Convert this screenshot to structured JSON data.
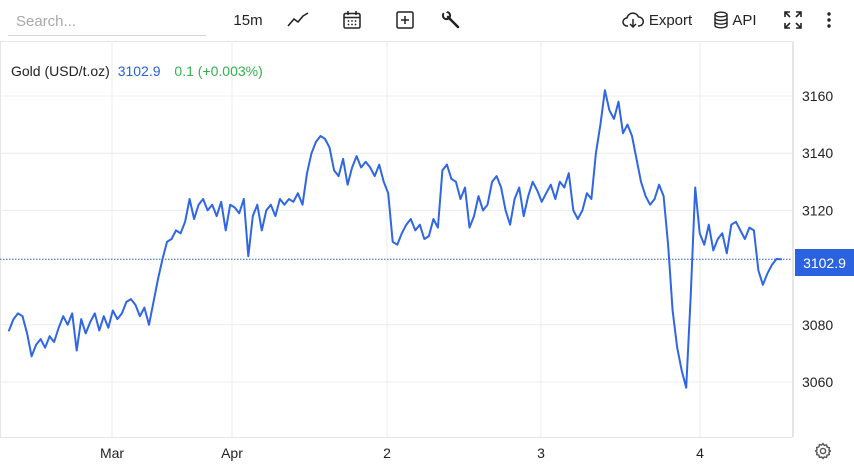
{
  "toolbar": {
    "search_placeholder": "Search...",
    "interval": "15m",
    "export_label": "Export",
    "api_label": "API"
  },
  "legend": {
    "symbol": "Gold (USD/t.oz)",
    "price": "3102.9",
    "change": "0.1 (+0.003%)"
  },
  "price_tag": "3102.9",
  "colors": {
    "line": "#2f66e6",
    "grid": "#ececec",
    "price_tag_bg": "#2a62e0",
    "change_positive": "#33b24a"
  },
  "chart_data": {
    "type": "line",
    "series": [
      {
        "values": [
          3078,
          3082,
          3084,
          3083,
          3077,
          3069,
          3073,
          3075,
          3072,
          3076,
          3074,
          3079,
          3083,
          3080,
          3084,
          3071,
          3082,
          3077,
          3081,
          3084,
          3078,
          3083,
          3079,
          3085,
          3082,
          3084,
          3088,
          3089,
          3087,
          3083,
          3086,
          3080,
          3088,
          3096,
          3103,
          3109,
          3110,
          3113,
          3112,
          3116,
          3124,
          3117,
          3122,
          3124,
          3120,
          3122,
          3118,
          3123,
          3113,
          3122,
          3121,
          3119,
          3124,
          3104,
          3118,
          3122,
          3113,
          3120,
          3122,
          3118,
          3124,
          3122,
          3124,
          3123,
          3126,
          3122,
          3133,
          3140,
          3144,
          3146,
          3145,
          3142,
          3134,
          3132,
          3138,
          3129,
          3135,
          3139,
          3135,
          3137,
          3135,
          3132,
          3136,
          3130,
          3126,
          3109,
          3108,
          3112,
          3115,
          3117,
          3113,
          3115,
          3110,
          3111,
          3117,
          3114,
          3134,
          3136,
          3131,
          3130,
          3124,
          3128,
          3114,
          3118,
          3125,
          3120,
          3122,
          3130,
          3132,
          3128,
          3120,
          3115,
          3124,
          3128,
          3118,
          3125,
          3130,
          3127,
          3123,
          3126,
          3129,
          3124,
          3130,
          3128,
          3133,
          3120,
          3117,
          3120,
          3126,
          3124,
          3140,
          3150,
          3162,
          3155,
          3152,
          3158,
          3147,
          3150,
          3146,
          3138,
          3130,
          3125,
          3122,
          3124,
          3129,
          3125,
          3108,
          3085,
          3072,
          3064,
          3058,
          3090,
          3128,
          3112,
          3108,
          3115,
          3106,
          3110,
          3112,
          3105,
          3115,
          3116,
          3113,
          3110,
          3114,
          3113,
          3099,
          3094,
          3098,
          3101,
          3103,
          3102.9
        ]
      }
    ],
    "x_tick_labels": [
      "Mar",
      "Apr",
      "2",
      "3",
      "4"
    ],
    "y_tick_labels": [
      "3160",
      "3140",
      "3120",
      "3080",
      "3060"
    ],
    "ylim": [
      3051,
      3170
    ],
    "last_price": 3102.9,
    "grid": true,
    "y_axis_position": "right"
  }
}
